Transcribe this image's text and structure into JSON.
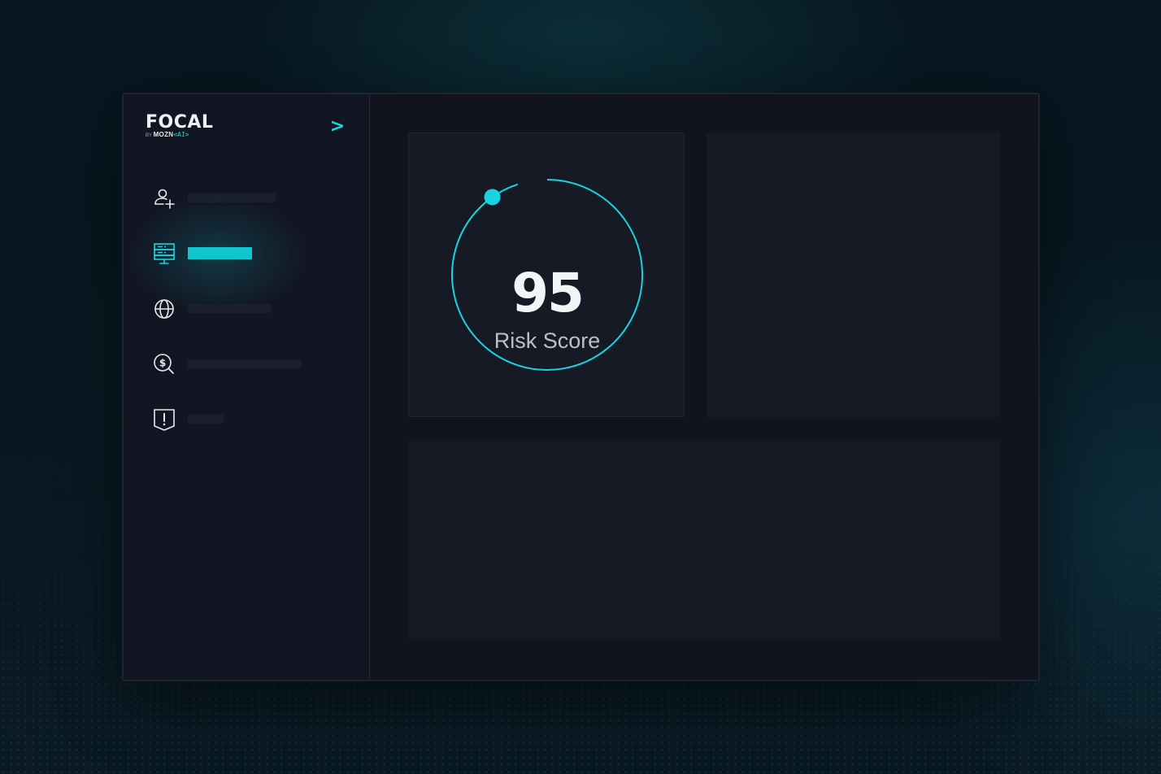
{
  "app": {
    "logo_text": "FOCAL",
    "logo_by": "BY",
    "logo_brand": "MOZN",
    "logo_ai": "<AI>",
    "expand_icon": "chevron-right-icon",
    "accent_color": "#18d4de"
  },
  "sidebar": {
    "items": [
      {
        "icon": "user-add-icon",
        "active": false
      },
      {
        "icon": "server-monitor-icon",
        "active": true
      },
      {
        "icon": "globe-icon",
        "active": false
      },
      {
        "icon": "money-search-icon",
        "active": false
      },
      {
        "icon": "alert-shield-icon",
        "active": false
      }
    ]
  },
  "risk": {
    "score": "95",
    "label": "Risk Score",
    "score_fraction": 0.95
  }
}
